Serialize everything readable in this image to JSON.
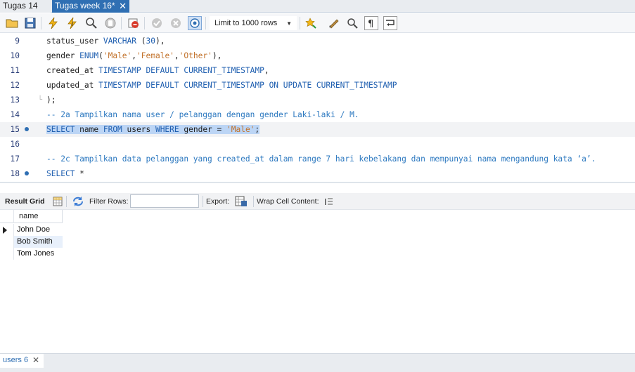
{
  "tabs": [
    {
      "label": "Tugas 14",
      "active": false
    },
    {
      "label": "Tugas week 16*",
      "active": true
    }
  ],
  "toolbar": {
    "icons": [
      "open-folder-icon",
      "save-icon",
      "execute-lightning-icon",
      "execute-current-icon",
      "explain-magnifier-icon",
      "stop-icon",
      "toggle-autocommit-icon",
      "commit-check-icon",
      "rollback-icon",
      "toggle-continue-icon",
      "beautify-icon",
      "find-icon",
      "invisible-chars-icon",
      "wrap-icon"
    ],
    "limit_label": "Limit to 1000 rows"
  },
  "editor": {
    "lines": [
      {
        "num": "9",
        "bullet": false,
        "segments": [
          [
            "code",
            "status_user "
          ],
          [
            "kw",
            "VARCHAR"
          ],
          [
            "code",
            " ("
          ],
          [
            "num",
            "30"
          ],
          [
            "code",
            "),"
          ]
        ]
      },
      {
        "num": "10",
        "bullet": false,
        "segments": [
          [
            "code",
            "gender "
          ],
          [
            "kw",
            "ENUM"
          ],
          [
            "code",
            "("
          ],
          [
            "str",
            "'Male'"
          ],
          [
            "code",
            ","
          ],
          [
            "str",
            "'Female'"
          ],
          [
            "code",
            ","
          ],
          [
            "str",
            "'Other'"
          ],
          [
            "code",
            "),"
          ]
        ]
      },
      {
        "num": "11",
        "bullet": false,
        "segments": [
          [
            "code",
            "created_at "
          ],
          [
            "kw",
            "TIMESTAMP DEFAULT CURRENT_TIMESTAMP"
          ],
          [
            "code",
            ","
          ]
        ]
      },
      {
        "num": "12",
        "bullet": false,
        "segments": [
          [
            "code",
            "updated_at "
          ],
          [
            "kw",
            "TIMESTAMP DEFAULT CURRENT_TIMESTAMP ON UPDATE CURRENT_TIMESTAMP"
          ]
        ]
      },
      {
        "num": "13",
        "bullet": false,
        "segments": [
          [
            "code",
            ");"
          ]
        ]
      },
      {
        "num": "14",
        "bullet": false,
        "segments": [
          [
            "cmt",
            "-- 2a Tampilkan nama user / pelanggan dengan gender Laki-laki / M."
          ]
        ]
      },
      {
        "num": "15",
        "bullet": true,
        "selected": true,
        "segments": [
          [
            "kw",
            "SELECT"
          ],
          [
            "code",
            " name "
          ],
          [
            "kw",
            "FROM"
          ],
          [
            "code",
            " users "
          ],
          [
            "kw",
            "WHERE"
          ],
          [
            "code",
            " gender = "
          ],
          [
            "str",
            "'Male'"
          ],
          [
            "code",
            ";"
          ]
        ]
      },
      {
        "num": "16",
        "bullet": false,
        "segments": []
      },
      {
        "num": "17",
        "bullet": false,
        "segments": [
          [
            "cmt",
            "-- 2c Tampilkan data pelanggan yang created_at dalam range 7 hari kebelakang dan mempunyai nama mengandung kata ‘a’."
          ]
        ]
      },
      {
        "num": "18",
        "bullet": true,
        "segments": [
          [
            "kw",
            "SELECT"
          ],
          [
            "code",
            " *"
          ]
        ]
      }
    ]
  },
  "result_toolbar": {
    "result_grid_label": "Result Grid",
    "filter_rows_label": "Filter Rows:",
    "filter_value": "",
    "export_label": "Export:",
    "wrap_label": "Wrap Cell Content:"
  },
  "grid": {
    "column": "name",
    "rows": [
      "John Doe",
      "Bob Smith",
      "Tom Jones"
    ]
  },
  "bottom": {
    "tab_label": "users 6"
  }
}
